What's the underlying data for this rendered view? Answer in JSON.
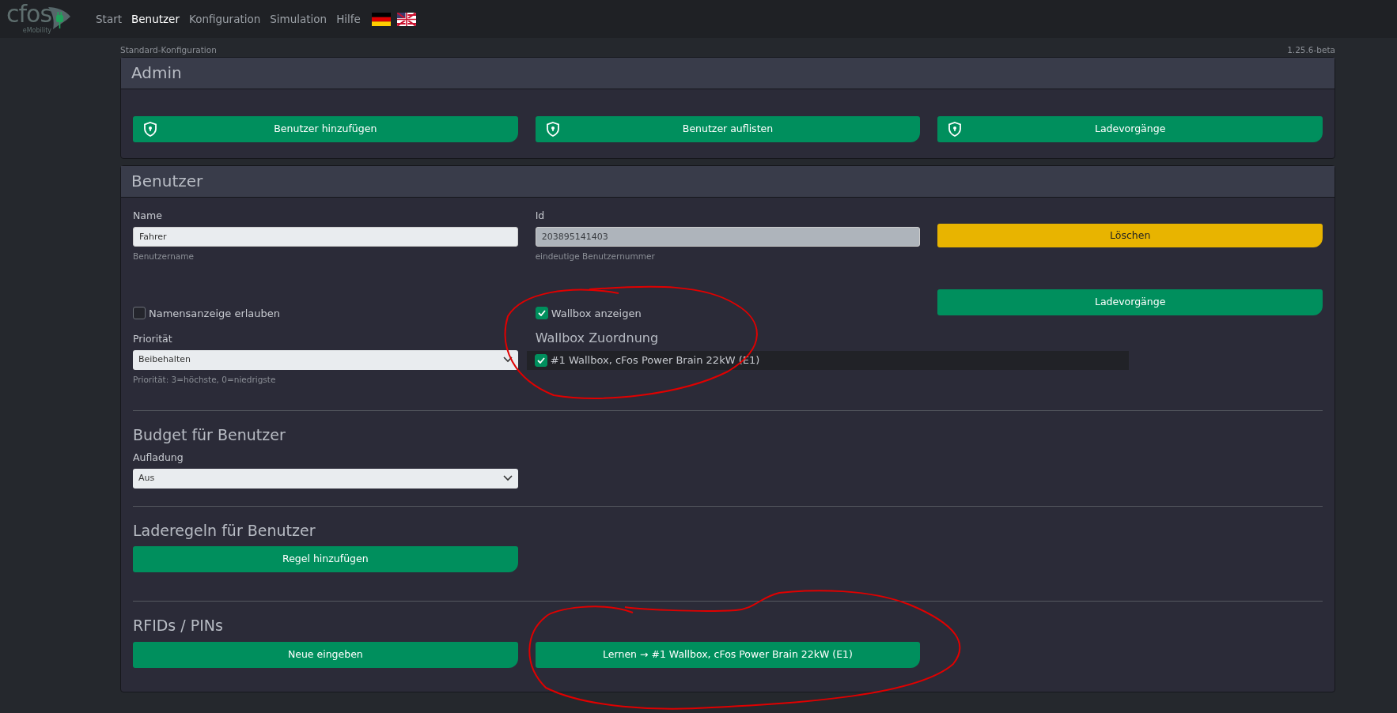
{
  "logo": {
    "name": "cfos",
    "tagline": "eMobility"
  },
  "nav": [
    {
      "label": "Start",
      "selected": false
    },
    {
      "label": "Benutzer",
      "selected": true
    },
    {
      "label": "Konfiguration",
      "selected": false
    },
    {
      "label": "Simulation",
      "selected": false
    },
    {
      "label": "Hilfe",
      "selected": false
    }
  ],
  "languages": [
    {
      "kind": "de"
    },
    {
      "kind": "en"
    }
  ],
  "config_name": "Standard-Konfiguration",
  "version": "1.25.6-beta",
  "admin": {
    "title": "Admin",
    "buttons": [
      "Benutzer hinzufügen",
      "Benutzer auflisten",
      "Ladevorgänge"
    ]
  },
  "user": {
    "title": "Benutzer",
    "name": {
      "label": "Name",
      "value": "Fahrer",
      "help": "Benutzername"
    },
    "id": {
      "label": "Id",
      "value": "203895141403",
      "help": "eindeutige Benutzernummer",
      "disabled": true
    },
    "delete_button": "Löschen",
    "charges_button": "Ladevorgänge",
    "show_name": {
      "label": "Namensanzeige erlauben",
      "checked": false
    },
    "show_wallbox": {
      "label": "Wallbox anzeigen",
      "checked": true
    },
    "priority": {
      "label": "Priorität",
      "value": "Beibehalten",
      "help": "Priorität: 3=höchste, 0=niedrigste"
    },
    "wallbox_assignment": {
      "title": "Wallbox Zuordnung",
      "items": [
        {
          "label": "#1 Wallbox, cFos Power Brain 22kW (E1)",
          "checked": true
        }
      ]
    },
    "budget": {
      "title": "Budget für Benutzer",
      "label": "Aufladung",
      "value": "Aus"
    },
    "rules": {
      "title": "Laderegeln für Benutzer",
      "button": "Regel hinzufügen"
    },
    "rfid": {
      "title": "RFIDs / PINs",
      "buttons": [
        "Neue eingeben",
        "Lernen → #1 Wallbox, cFos Power Brain 22kW (E1)"
      ]
    }
  },
  "markings": [
    {
      "kind": "freehand-loop"
    },
    {
      "kind": "freehand-loop"
    }
  ]
}
